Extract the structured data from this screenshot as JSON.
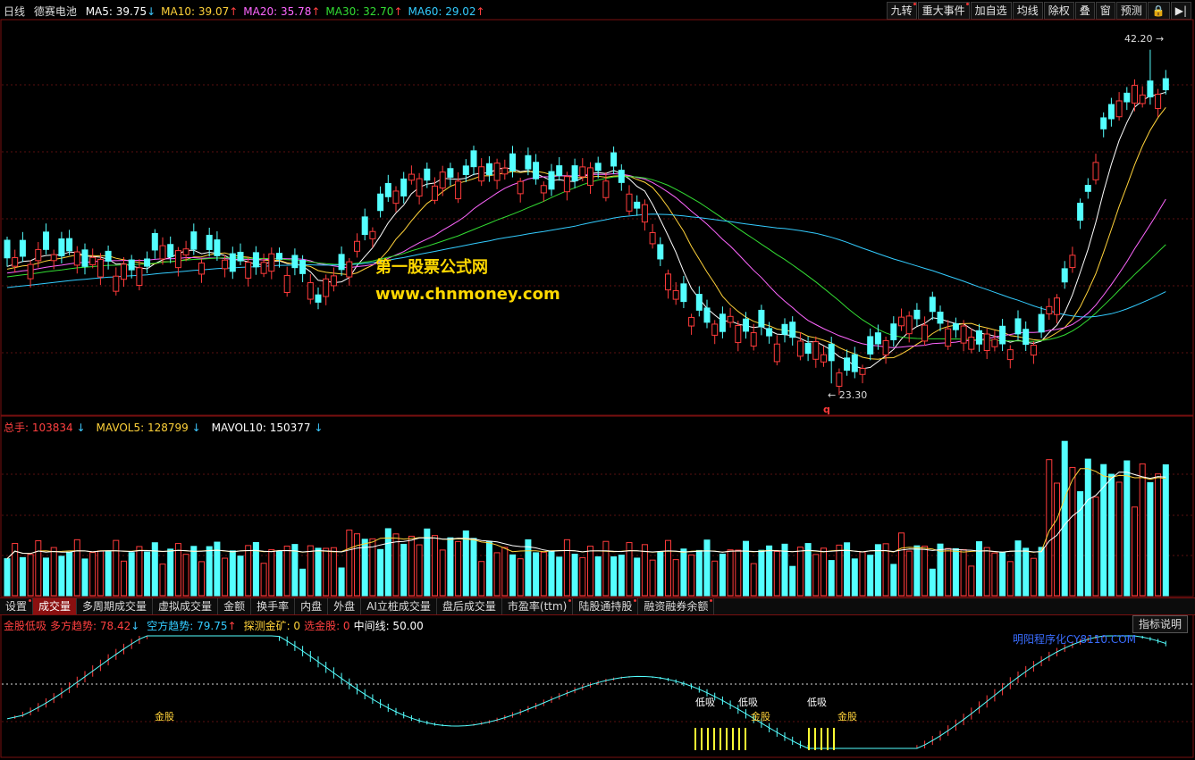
{
  "header": {
    "period": "日线",
    "stock": "德赛电池",
    "ma": [
      {
        "label": "MA5: 39.75",
        "arrow": "↓",
        "color": "#ffffff",
        "arrow_color": "#3ec8ff"
      },
      {
        "label": "MA10: 39.07",
        "arrow": "↑",
        "color": "#ffd23a",
        "arrow_color": "#ff4040"
      },
      {
        "label": "MA20: 35.78",
        "arrow": "↑",
        "color": "#ff66ff",
        "arrow_color": "#ff4040"
      },
      {
        "label": "MA30: 32.70",
        "arrow": "↑",
        "color": "#33dd33",
        "arrow_color": "#ff4040"
      },
      {
        "label": "MA60: 29.02",
        "arrow": "↑",
        "color": "#33ccff",
        "arrow_color": "#ff4040"
      }
    ]
  },
  "toolbar": [
    "九转",
    "重大事件",
    "加自选",
    "均线",
    "除权",
    "叠",
    "窗",
    "预测"
  ],
  "price_labels": {
    "high": "42.20",
    "low": "23.30",
    "q_mark": "q"
  },
  "watermark": {
    "line1": "第一股票公式网",
    "line2": "www.chnmoney.com",
    "line3": "明阳程序化CY8110.COM"
  },
  "volume_header": [
    {
      "label": "总手: 103834",
      "arrow": "↓",
      "color": "#ff4040"
    },
    {
      "label": "MAVOL5: 128799",
      "arrow": "↓",
      "color": "#ffd23a"
    },
    {
      "label": "MAVOL10: 150377",
      "arrow": "↓",
      "color": "#ffffff"
    }
  ],
  "tabs": [
    {
      "label": "设置",
      "dot": true
    },
    {
      "label": "成交量",
      "active": true
    },
    {
      "label": "多周期成交量"
    },
    {
      "label": "虚拟成交量"
    },
    {
      "label": "金额"
    },
    {
      "label": "换手率"
    },
    {
      "label": "内盘"
    },
    {
      "label": "外盘"
    },
    {
      "label": "AI立桩成交量"
    },
    {
      "label": "盘后成交量"
    },
    {
      "label": "市盈率(ttm)",
      "dot": true
    },
    {
      "label": "陆股通持股",
      "dot": true
    },
    {
      "label": "融资融券余额",
      "dot": true
    }
  ],
  "indicator_header": [
    {
      "label": "金股低吸",
      "color": "#ff4040"
    },
    {
      "label": "多方趋势: 78.42",
      "arrow": "↓",
      "color": "#ff4040",
      "arrow_color": "#3ec8ff"
    },
    {
      "label": "空方趋势: 79.75",
      "arrow": "↑",
      "color": "#33ccff",
      "arrow_color": "#ff4040"
    },
    {
      "label": "探测金矿: 0",
      "color": "#ffd23a"
    },
    {
      "label": "选金股: 0",
      "color": "#ff4040"
    },
    {
      "label": "中间线: 50.00",
      "color": "#ffffff"
    }
  ],
  "indicator_button": "指标说明",
  "indicator_labels": {
    "dixi": "低吸",
    "jingu": "金股"
  }
}
